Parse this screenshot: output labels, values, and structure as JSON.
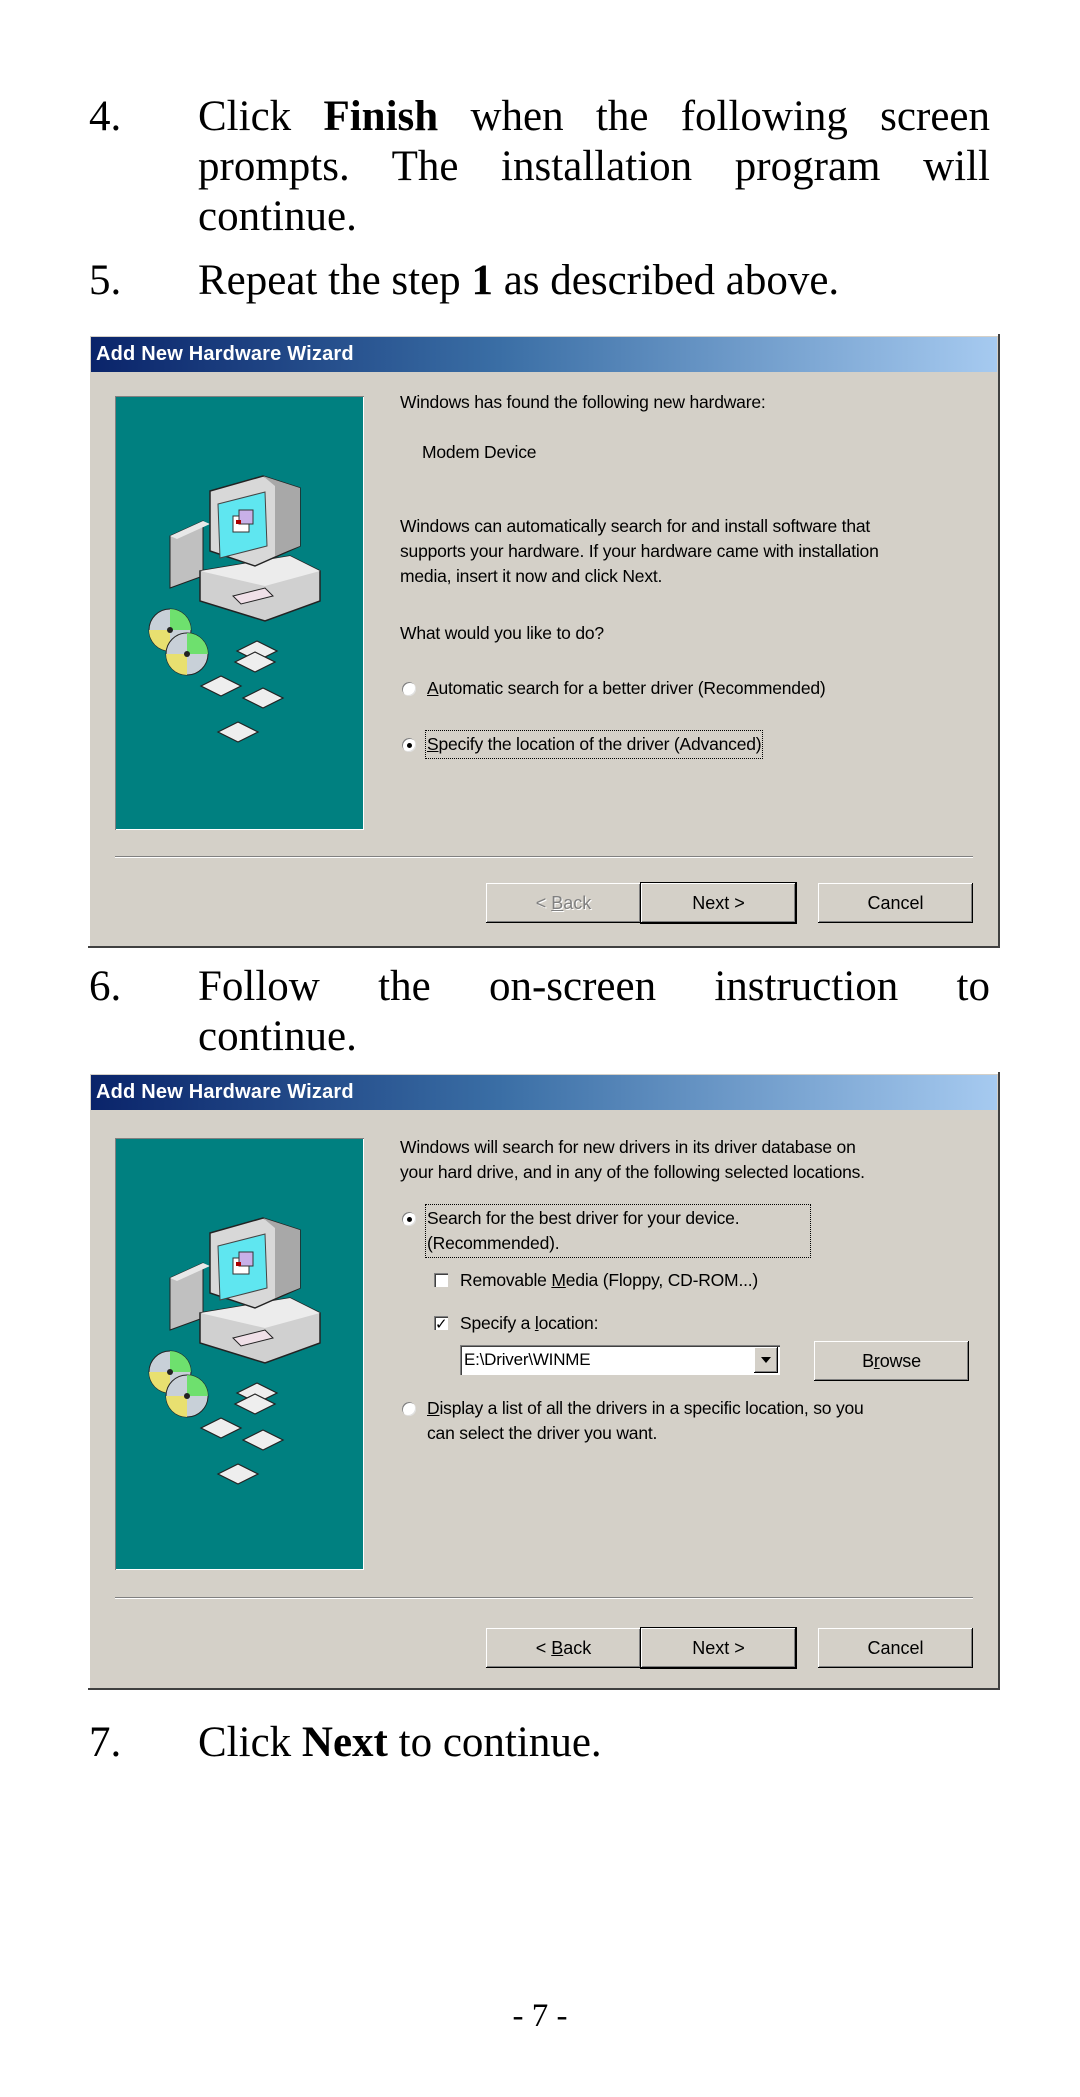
{
  "steps": [
    {
      "num": "4.",
      "pre": "Click ",
      "bold": "Finish",
      "post": " when the following screen prompts.  The installation program will continue."
    },
    {
      "num": "5.",
      "pre": "Repeat the step ",
      "bold": "1",
      "post": " as described above."
    },
    {
      "num": "6.",
      "pre": "Follow the on-screen instruction to",
      "bold": "",
      "post": "",
      "line2": "continue."
    },
    {
      "num": "7.",
      "pre": "Click ",
      "bold": "Next",
      "post": " to continue."
    }
  ],
  "dialog1": {
    "title": "Add New Hardware Wizard",
    "found_label": "Windows has found the following new hardware:",
    "device_name": "Modem Device",
    "desc_lines": [
      "Windows can automatically search for and install software that",
      "supports your hardware. If your hardware came with installation",
      "media, insert it now and click Next."
    ],
    "question": "What would you like to do?",
    "options": [
      {
        "mnemonic": "A",
        "rest": "utomatic search for a better driver (Recommended)",
        "checked": false
      },
      {
        "mnemonic": "S",
        "rest": "pecify the location of the driver (Advanced)",
        "checked": true
      }
    ],
    "buttons": {
      "back": {
        "pre": "< ",
        "mnemonic": "B",
        "rest": "ack",
        "enabled": false
      },
      "next": "Next >",
      "cancel": "Cancel"
    }
  },
  "dialog2": {
    "title": "Add New Hardware Wizard",
    "desc_lines": [
      "Windows will search for new drivers in its driver database on",
      "your hard drive, and in any of the following selected locations."
    ],
    "search_option": {
      "line1": "Search for the best driver for your device.",
      "line2": "(Recommended).",
      "checked": true
    },
    "removable_media": {
      "pre": "Removable ",
      "mnemonic": "M",
      "rest": "edia (Floppy, CD-ROM...)",
      "checked": false
    },
    "specify_location": {
      "pre": "Specify a ",
      "mnemonic": "l",
      "rest": "ocation:",
      "checked": true
    },
    "location_value": "E:\\Driver\\WINME",
    "browse": {
      "pre": "B",
      "mnemonic": "r",
      "rest": "owse"
    },
    "display_option": {
      "mnemonic": "D",
      "rest": "isplay a list of all the drivers in a specific location, so you",
      "line2": "can select the driver you want.",
      "checked": false
    },
    "buttons": {
      "back": {
        "pre": "< ",
        "mnemonic": "B",
        "rest": "ack",
        "enabled": true
      },
      "next": "Next >",
      "cancel": "Cancel"
    }
  },
  "colors": {
    "dialog_face": "#d4d0c8",
    "title_start": "#0a246a",
    "title_end": "#a6caf0",
    "side_panel": "#008080"
  },
  "page_number": "- 7 -"
}
